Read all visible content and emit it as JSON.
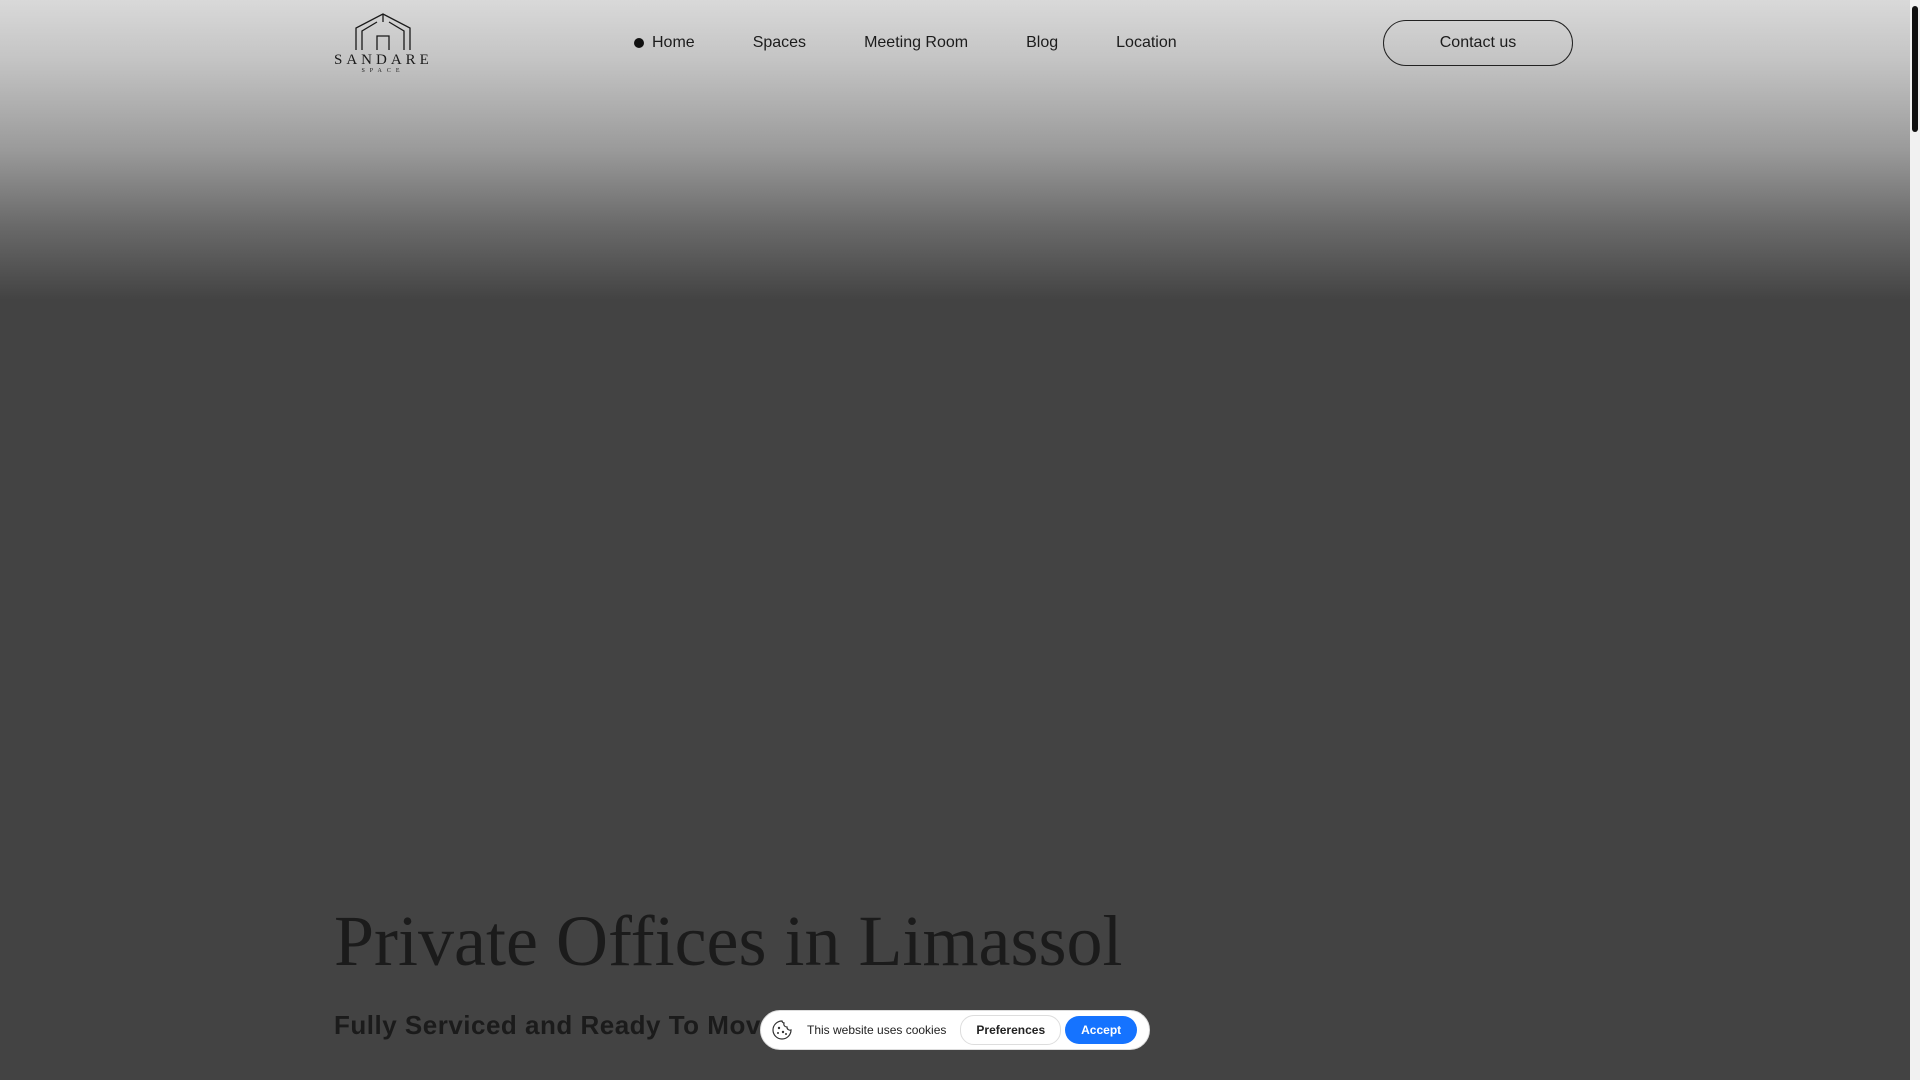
{
  "logo": {
    "name": "SANDARE",
    "sub": "SPACE"
  },
  "nav": {
    "items": [
      {
        "label": "Home",
        "active": true
      },
      {
        "label": "Spaces"
      },
      {
        "label": "Meeting Room"
      },
      {
        "label": "Blog"
      },
      {
        "label": "Location"
      }
    ],
    "contact_label": "Contact us"
  },
  "hero": {
    "title": "Private Offices in Limassol",
    "subtitle": "Fully Serviced and Ready To Move"
  },
  "cookie": {
    "text": "This website uses cookies",
    "preferences_label": "Preferences",
    "accept_label": "Accept",
    "accept_color": "#1573ff"
  },
  "colors": {
    "hero_background": "#434343",
    "text": "#1b1b1b"
  }
}
